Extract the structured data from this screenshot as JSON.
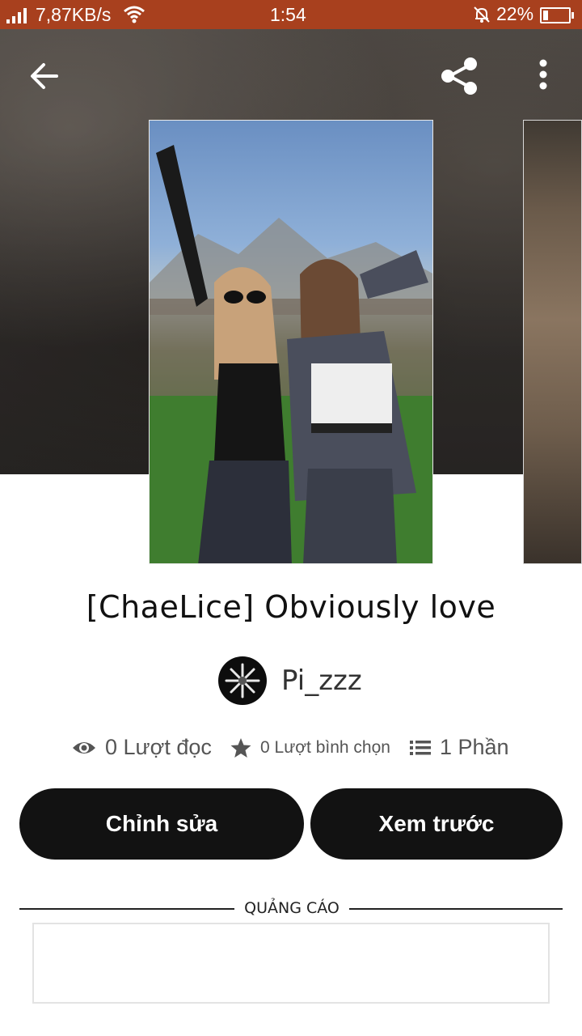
{
  "status_bar": {
    "network_speed": "7,87KB/s",
    "time": "1:54",
    "battery_percent": "22%",
    "battery_level": 0.22,
    "icons": [
      "signal-icon",
      "wifi-icon",
      "mute-icon",
      "battery-icon"
    ]
  },
  "toolbar": {
    "icons": [
      "back-arrow-icon",
      "share-icon",
      "more-vertical-icon"
    ]
  },
  "story": {
    "title": "[ChaeLice] Obviously love",
    "author": "Pi_zzz",
    "reads": "0 Lượt đọc",
    "votes": "0 Lượt bình chọn",
    "parts": "1 Phần"
  },
  "actions": {
    "edit_label": "Chỉnh sửa",
    "preview_label": "Xem trước"
  },
  "ad": {
    "label": "QUẢNG CÁO"
  },
  "colors": {
    "status_bar": "#a8401e",
    "button_bg": "#121212",
    "button_text": "#ffffff"
  }
}
